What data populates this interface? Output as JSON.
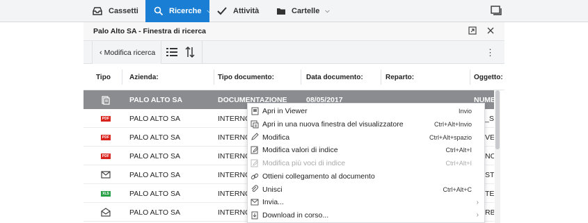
{
  "nav": {
    "tabs": [
      {
        "label": "Cassetti",
        "icon": "inbox-tray-icon"
      },
      {
        "label": "Ricerche",
        "icon": "search-icon",
        "active": true
      },
      {
        "label": "Attività",
        "icon": "checkmark-icon"
      },
      {
        "label": "Cartelle",
        "icon": "folder-icon"
      }
    ]
  },
  "panel": {
    "title": "Palo Alto SA - Finestra di ricerca"
  },
  "toolbar": {
    "back_label": "Modifica ricerca"
  },
  "table": {
    "columns": [
      "Tipo",
      "Azienda:",
      "Tipo documento:",
      "Data documento:",
      "Reparto:",
      "Oggetto:"
    ],
    "rows": [
      {
        "icon": "scan-doc-icon",
        "azienda": "PALO ALTO SA",
        "tipo_doc": "DOCUMENTAZIONE",
        "data": "08/05/2017",
        "oggetto": "NUME",
        "selected": true
      },
      {
        "icon": "pdf-icon",
        "azienda": "PALO ALTO SA",
        "tipo_doc": "INTERNO",
        "data": "",
        "oggetto": "_SI"
      },
      {
        "icon": "pdf-icon",
        "azienda": "PALO ALTO SA",
        "tipo_doc": "INTERNO",
        "data": "",
        "oggetto": "VE"
      },
      {
        "icon": "pdf-icon",
        "azienda": "PALO ALTO SA",
        "tipo_doc": "INTERNO",
        "data": "",
        "oggetto": "NC"
      },
      {
        "icon": "envelope-icon",
        "azienda": "PALO ALTO SA",
        "tipo_doc": "INTERNO",
        "data": "",
        "oggetto": "STI"
      },
      {
        "icon": "xls-icon",
        "azienda": "PALO ALTO SA",
        "tipo_doc": "INTERNO",
        "data": "",
        "oggetto": "TE"
      },
      {
        "icon": "envelope-open-icon",
        "azienda": "PALO ALTO SA",
        "tipo_doc": "INTERNO",
        "data": "",
        "oggetto": "RB"
      }
    ],
    "pdf_badge": "PDF",
    "xls_badge": "XLS"
  },
  "context_menu": {
    "items": [
      {
        "label": "Apri in Viewer",
        "shortcut": "Invio",
        "icon": "viewer-icon"
      },
      {
        "label": "Apri in una nuova finestra del visualizzatore",
        "shortcut": "Ctrl+Alt+Invio",
        "icon": "new-window-icon"
      },
      {
        "label": "Modifica",
        "shortcut": "Ctrl+Alt+spazio",
        "icon": "pencil-icon"
      },
      {
        "label": "Modifica valori di indice",
        "shortcut": "Ctrl+Alt+I",
        "icon": "edit-index-icon"
      },
      {
        "label": "Modifica più voci di indice",
        "shortcut": "Ctrl+Alt+I",
        "icon": "edit-multi-index-icon",
        "disabled": true
      },
      {
        "label": "Ottieni collegamento al documento",
        "shortcut": "",
        "icon": "link-icon"
      },
      {
        "label": "Unisci",
        "shortcut": "Ctrl+Alt+C",
        "icon": "paperclip-icon"
      },
      {
        "label": "Invia...",
        "shortcut": "",
        "icon": "mail-icon",
        "submenu": true
      },
      {
        "label": "Download in corso...",
        "shortcut": "",
        "icon": "download-icon",
        "submenu": true
      }
    ]
  },
  "colors": {
    "accent": "#1a7fd4",
    "selected_row": "#8a8c90",
    "pdf_red": "#d9241d",
    "xls_green": "#27a046"
  }
}
